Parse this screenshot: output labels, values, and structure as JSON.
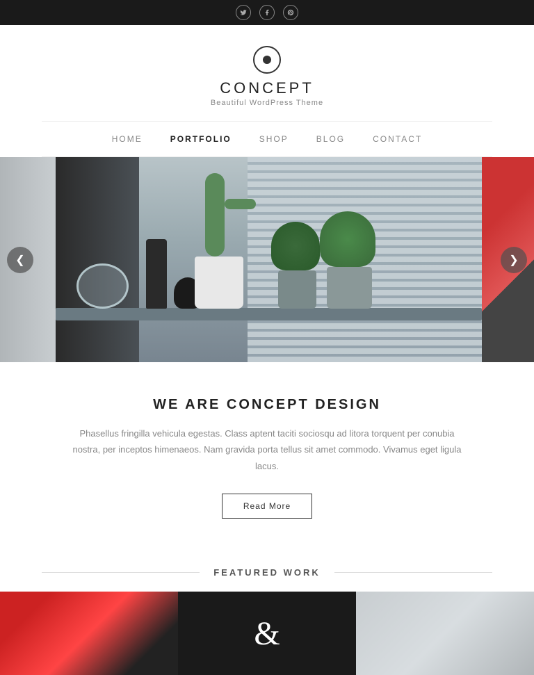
{
  "topbar": {
    "social": [
      {
        "name": "twitter",
        "symbol": "𝕋"
      },
      {
        "name": "facebook",
        "symbol": "f"
      },
      {
        "name": "pinterest",
        "symbol": "p"
      }
    ]
  },
  "header": {
    "brand": "CONCEPT",
    "tagline": "Beautiful WordPress Theme"
  },
  "nav": {
    "items": [
      {
        "label": "HOME",
        "active": false
      },
      {
        "label": "PORTFOLIO",
        "active": true
      },
      {
        "label": "SHOP",
        "active": false
      },
      {
        "label": "BLOG",
        "active": false
      },
      {
        "label": "CONTACT",
        "active": false
      }
    ]
  },
  "slider": {
    "prev_label": "❮",
    "next_label": "❯"
  },
  "about": {
    "title": "WE ARE CONCEPT DESIGN",
    "body": "Phasellus fringilla vehicula egestas. Class aptent taciti sociosqu ad litora torquent per conubia nostra, per inceptos himenaeos. Nam gravida porta tellus sit amet commodo. Vivamus eget ligula lacus.",
    "button_label": "Read More"
  },
  "featured": {
    "title": "FEATURED WORK",
    "ampersand": "&"
  }
}
